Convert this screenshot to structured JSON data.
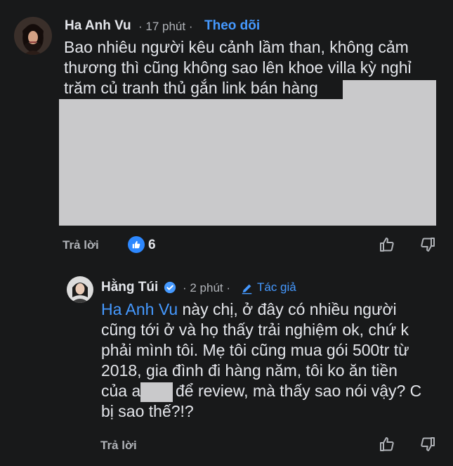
{
  "comment": {
    "author": "Ha Anh Vu",
    "time": "· 17 phút ·",
    "follow_label": "Theo dõi",
    "lines": [
      "Bao nhiêu người kêu cảnh lầm than, không cảm",
      "thương thì cũng không sao lên khoe villa kỳ nghỉ",
      "trăm củ tranh thủ gắn link bán hàng"
    ],
    "reply_label": "Trả lời",
    "like_count": "6"
  },
  "reply": {
    "author": "Hằng Túi",
    "time": "· 2 phút ·",
    "author_tag": "Tác giả",
    "mention": "Ha Anh Vu",
    "lines": [
      " này chị, ở đây có nhiều người",
      "cũng tới ở và họ thấy trải nghiệm ok, chứ k",
      "phải mình tôi. Mẹ tôi cũng mua gói 500tr từ",
      "2018, gia đình đi hàng năm, tôi ko ăn tiền",
      "của a",
      "để review, mà thấy sao nói vậy? C",
      "bị sao thế?!?"
    ],
    "reply_label": "Trả lời"
  },
  "icons": {
    "like": "thumbs-up-outline-icon",
    "dislike": "thumbs-down-outline-icon",
    "like_reaction": "like-reaction-icon",
    "verified": "verified-badge-icon",
    "author": "pencil-icon"
  },
  "colors": {
    "background": "#18191a",
    "text": "#e4e6eb",
    "secondary": "#b0b3b8",
    "link": "#4599ff",
    "like_blue": "#2d88ff",
    "redaction": "#c9c9cb"
  }
}
